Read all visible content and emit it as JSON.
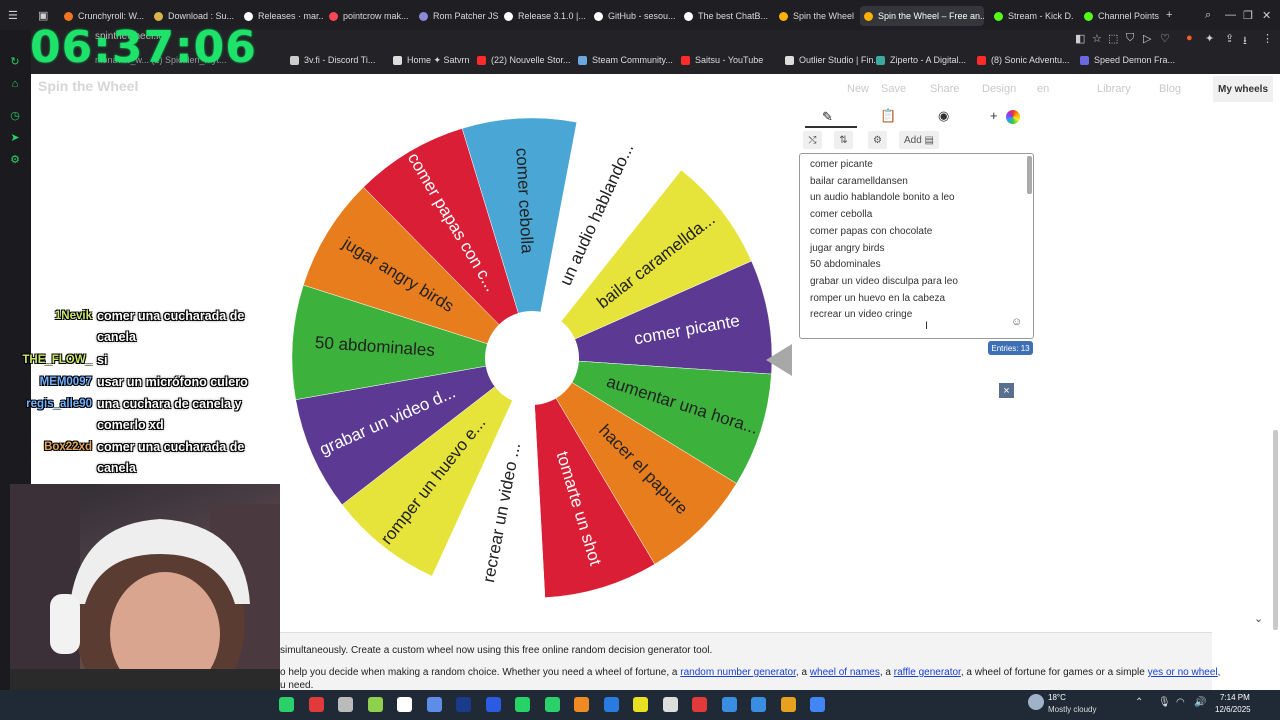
{
  "browser": {
    "tabs": [
      {
        "label": "Crunchyroll: W...",
        "color": "#f47521"
      },
      {
        "label": "Download : Su...",
        "color": "#d9b44a"
      },
      {
        "label": "Releases · mar...",
        "color": "#ffffff"
      },
      {
        "label": "pointcrow mak...",
        "color": "#ff4655"
      },
      {
        "label": "Rom Patcher JS",
        "color": "#8a8ad8"
      },
      {
        "label": "Release 3.1.0 |...",
        "color": "#ffffff"
      },
      {
        "label": "GitHub - sesou...",
        "color": "#ffffff"
      },
      {
        "label": "The best ChatB...",
        "color": "#ffffff"
      },
      {
        "label": "Spin the Wheel",
        "color": "#ffb000"
      },
      {
        "label": "Spin the Wheel – Free an...",
        "color": "#ffb000"
      },
      {
        "label": "Stream - Kick D...",
        "color": "#53fc18"
      },
      {
        "label": "Channel Points",
        "color": "#53fc18"
      }
    ],
    "address": "spinthewheel.io",
    "bookmarks": [
      {
        "label": "3v.fi - Discord Ti...",
        "color": "#cccccc"
      },
      {
        "label": "Home ✦ Satvrn",
        "color": "#dddddd"
      },
      {
        "label": "(22) Nouvelle Stor...",
        "color": "#ff2a2a"
      },
      {
        "label": "Steam Community...",
        "color": "#6aa9e0"
      },
      {
        "label": "Saitsu - YouTube",
        "color": "#ff2a2a"
      },
      {
        "label": "Outlier Studio | Fin...",
        "color": "#dddddd"
      },
      {
        "label": "Ziperto - A Digital...",
        "color": "#3aaaa0"
      },
      {
        "label": "(8) Sonic Adventu...",
        "color": "#ff2a2a"
      },
      {
        "label": "Speed Demon Fra...",
        "color": "#6a6ae0"
      }
    ],
    "partial_bookmarks": "ntonaviw_w...   (2) Spicalen_myt..."
  },
  "overlay": {
    "clock": "06:37:06",
    "chat": [
      {
        "name": "1Nevik",
        "name_color": "#c9e86b",
        "message": "comer una cucharada de canela"
      },
      {
        "name": "THE_FLOW_",
        "name_color": "#c9e86b",
        "message": "si"
      },
      {
        "name": "MEM0097",
        "name_color": "#6fb0ff",
        "message": "usar un micrófono culero"
      },
      {
        "name": "regis_alle90",
        "name_color": "#6fb0ff",
        "message": "una cuchara de canela y comerlo xd"
      },
      {
        "name": "Box22xd",
        "name_color": "#e0a45a",
        "message": "comer una cucharada de canela"
      }
    ]
  },
  "site": {
    "logo": "Spin the Wheel",
    "nav": [
      "New",
      "Save",
      "Share",
      "Design",
      "en",
      "Library",
      "Blog"
    ],
    "my_wheels": "My wheels",
    "add_button": "Add",
    "entries_badge": "Entries: 13",
    "entries": [
      "comer picante",
      "bailar caramelldansen",
      "un audio hablandole bonito a leo",
      "comer cebolla",
      "comer papas con chocolate",
      "jugar angry birds",
      "50 abdominales",
      "grabar un video disculpa para leo",
      "romper un huevo en la cabeza",
      "recrear un video cringe"
    ],
    "close_symbol": "×"
  },
  "wheel": {
    "segments": [
      {
        "label": "comer picante",
        "color": "#5c3a94",
        "text_color": "#ffffff"
      },
      {
        "label": "aumentar una hora...",
        "color": "#3cb23c",
        "text_color": "#222222"
      },
      {
        "label": "hacer el papure",
        "color": "#e87d1e",
        "text_color": "#222222"
      },
      {
        "label": "tomarte un shot",
        "color": "#d91e35",
        "text_color": "#ffffff"
      },
      {
        "label": "recrear un video ...",
        "color": "#ffffff",
        "text_color": "#222222"
      },
      {
        "label": "romper un huevo e...",
        "color": "#e6e33a",
        "text_color": "#222222"
      },
      {
        "label": "grabar un video d...",
        "color": "#5c3a94",
        "text_color": "#ffffff"
      },
      {
        "label": "50 abdominales",
        "color": "#3cb23c",
        "text_color": "#222222"
      },
      {
        "label": "jugar angry birds",
        "color": "#e87d1e",
        "text_color": "#222222"
      },
      {
        "label": "comer papas con c...",
        "color": "#d91e35",
        "text_color": "#ffffff"
      },
      {
        "label": "comer cebolla",
        "color": "#4aa6d4",
        "text_color": "#222222"
      },
      {
        "label": "un audio hablando...",
        "color": "#ffffff",
        "text_color": "#222222"
      },
      {
        "label": "bailar caramellda...",
        "color": "#e6e33a",
        "text_color": "#222222"
      }
    ]
  },
  "bottom": {
    "line1": "simultaneously. Create a custom wheel now using this free online random decision generator tool.",
    "line2_start": "o help you decide when making a random choice. Whether you need a wheel of fortune, a",
    "links": [
      "random number generator",
      "wheel of names",
      "raffle generator",
      "yes or no wheel"
    ],
    "sep1": ", a",
    "sep2": ", a",
    "sep3": ", a wheel of fortune for games or a simple",
    "line2_end": ",",
    "line3": "u need."
  },
  "taskbar": {
    "temperature": "18°C",
    "weather": "Mostly cloudy",
    "time": "7:14 PM",
    "date": "12/6/2025"
  }
}
